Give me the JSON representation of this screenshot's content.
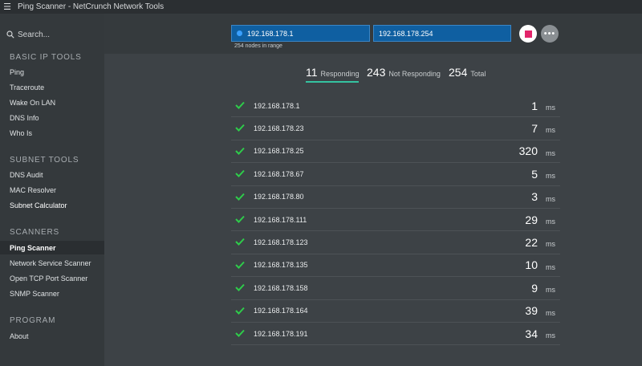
{
  "window": {
    "title": "Ping Scanner - NetCrunch Network Tools"
  },
  "sidebar": {
    "search_label": "Search...",
    "sections": [
      {
        "title": "BASIC IP TOOLS",
        "items": [
          "Ping",
          "Traceroute",
          "Wake On LAN",
          "DNS Info",
          "Who Is"
        ]
      },
      {
        "title": "SUBNET TOOLS",
        "items": [
          "DNS Audit",
          "MAC Resolver",
          "Subnet Calculator"
        ]
      },
      {
        "title": "SCANNERS",
        "items": [
          "Ping Scanner",
          "Network Service Scanner",
          "Open TCP Port Scanner",
          "SNMP Scanner"
        ]
      },
      {
        "title": "PROGRAM",
        "items": [
          "About"
        ]
      }
    ],
    "active_item": "Ping Scanner"
  },
  "scan": {
    "start_ip": "192.168.178.1",
    "end_ip": "192.168.178.254",
    "range_hint": "254 nodes in range"
  },
  "summary": {
    "responding_count": "11",
    "responding_label": "Responding",
    "not_responding_count": "243",
    "not_responding_label": "Not Responding",
    "total_count": "254",
    "total_label": "Total"
  },
  "results": [
    {
      "ip": "192.168.178.1",
      "time": "1",
      "unit": "ms"
    },
    {
      "ip": "192.168.178.23",
      "time": "7",
      "unit": "ms"
    },
    {
      "ip": "192.168.178.25",
      "time": "320",
      "unit": "ms"
    },
    {
      "ip": "192.168.178.67",
      "time": "5",
      "unit": "ms"
    },
    {
      "ip": "192.168.178.80",
      "time": "3",
      "unit": "ms"
    },
    {
      "ip": "192.168.178.111",
      "time": "29",
      "unit": "ms"
    },
    {
      "ip": "192.168.178.123",
      "time": "22",
      "unit": "ms"
    },
    {
      "ip": "192.168.178.135",
      "time": "10",
      "unit": "ms"
    },
    {
      "ip": "192.168.178.158",
      "time": "9",
      "unit": "ms"
    },
    {
      "ip": "192.168.178.164",
      "time": "39",
      "unit": "ms"
    },
    {
      "ip": "192.168.178.191",
      "time": "34",
      "unit": "ms"
    }
  ],
  "colors": {
    "accent": "#35c3a1",
    "input_bg": "#0f5fa1",
    "stop": "#e3256b",
    "check": "#2ecc4a"
  },
  "icons": {
    "menu": "hamburger-icon",
    "search": "search-icon",
    "stop": "stop-icon",
    "more": "more-icon",
    "status": "checkmark-icon"
  }
}
